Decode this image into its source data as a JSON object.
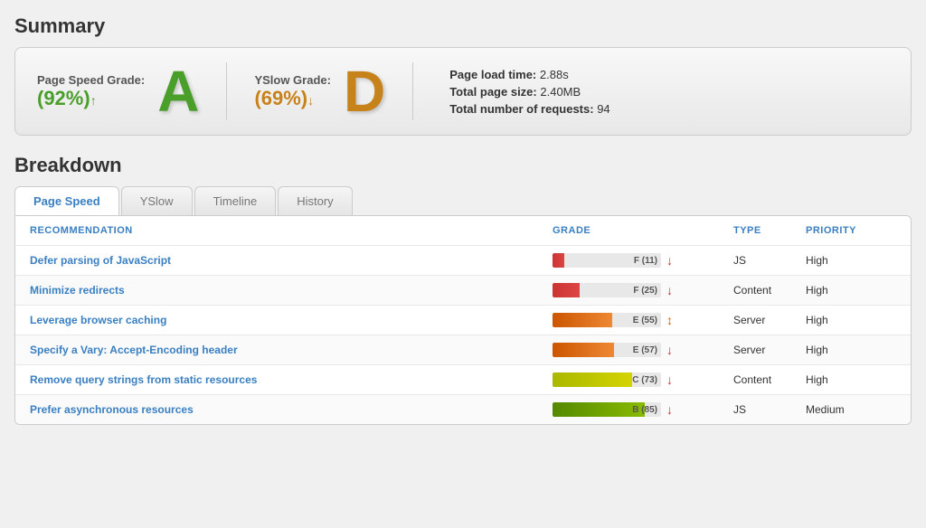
{
  "summary": {
    "title": "Summary",
    "pagespeed": {
      "label": "Page Speed Grade:",
      "pct": "(92%)",
      "arrow": "↑",
      "letter": "A"
    },
    "yslow": {
      "label": "YSlow Grade:",
      "pct": "(69%)",
      "arrow": "↓",
      "letter": "D"
    },
    "stats": {
      "load_time_label": "Page load time:",
      "load_time_value": "2.88s",
      "page_size_label": "Total page size:",
      "page_size_value": "2.40MB",
      "requests_label": "Total number of requests:",
      "requests_value": "94"
    }
  },
  "breakdown": {
    "title": "Breakdown",
    "tabs": [
      {
        "id": "pagespeed",
        "label": "Page Speed",
        "active": true
      },
      {
        "id": "yslow",
        "label": "YSlow",
        "active": false
      },
      {
        "id": "timeline",
        "label": "Timeline",
        "active": false
      },
      {
        "id": "history",
        "label": "History",
        "active": false
      }
    ],
    "table": {
      "headers": {
        "recommendation": "RECOMMENDATION",
        "grade": "GRADE",
        "type": "TYPE",
        "priority": "PRIORITY"
      },
      "rows": [
        {
          "recommendation": "Defer parsing of JavaScript",
          "grade_label": "F (11)",
          "grade_pct": 11,
          "grade_class": "bar-f",
          "arrow": "↓",
          "arrow_type": "down",
          "type": "JS",
          "priority": "High"
        },
        {
          "recommendation": "Minimize redirects",
          "grade_label": "F (25)",
          "grade_pct": 25,
          "grade_class": "bar-f",
          "arrow": "↓",
          "arrow_type": "down",
          "type": "Content",
          "priority": "High"
        },
        {
          "recommendation": "Leverage browser caching",
          "grade_label": "E (55)",
          "grade_pct": 55,
          "grade_class": "bar-e",
          "arrow": "↕",
          "arrow_type": "neutral",
          "type": "Server",
          "priority": "High"
        },
        {
          "recommendation": "Specify a Vary: Accept-Encoding header",
          "grade_label": "E (57)",
          "grade_pct": 57,
          "grade_class": "bar-e",
          "arrow": "↓",
          "arrow_type": "down",
          "type": "Server",
          "priority": "High"
        },
        {
          "recommendation": "Remove query strings from static resources",
          "grade_label": "C (73)",
          "grade_pct": 73,
          "grade_class": "bar-c",
          "arrow": "↓",
          "arrow_type": "down",
          "type": "Content",
          "priority": "High"
        },
        {
          "recommendation": "Prefer asynchronous resources",
          "grade_label": "B (85)",
          "grade_pct": 85,
          "grade_class": "bar-b",
          "arrow": "↓",
          "arrow_type": "down",
          "type": "JS",
          "priority": "Medium"
        }
      ]
    }
  }
}
